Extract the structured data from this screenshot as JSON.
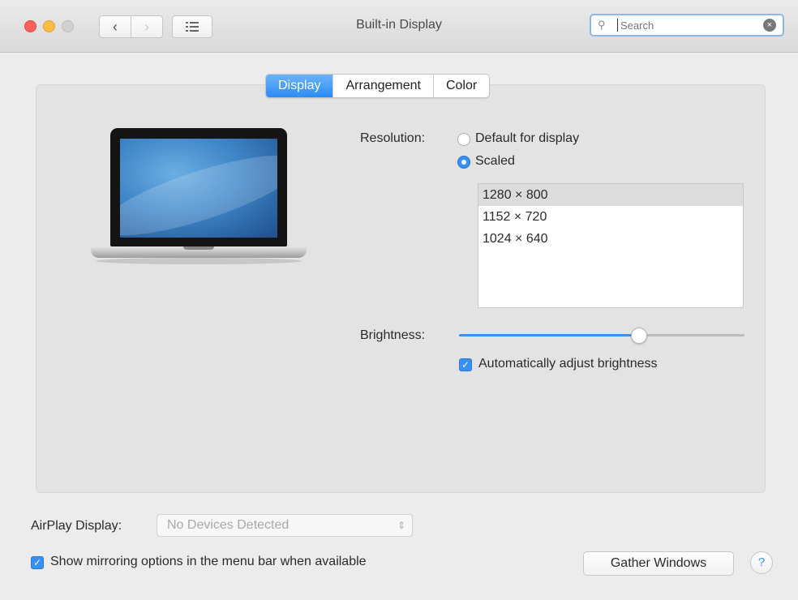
{
  "window": {
    "title": "Built-in Display",
    "search": {
      "placeholder": "Search",
      "value": ""
    },
    "nav": {
      "back": "‹",
      "forward": "›",
      "grid_icon": "grid-icon"
    }
  },
  "tabs": [
    {
      "label": "Display",
      "active": true
    },
    {
      "label": "Arrangement",
      "active": false
    },
    {
      "label": "Color",
      "active": false
    }
  ],
  "display": {
    "resolution_label": "Resolution:",
    "options": [
      {
        "label": "Default for display",
        "selected": false
      },
      {
        "label": "Scaled",
        "selected": true
      }
    ],
    "resolutions": [
      {
        "label": "1280 × 800",
        "selected": true
      },
      {
        "label": "1152 × 720",
        "selected": false
      },
      {
        "label": "1024 × 640",
        "selected": false
      }
    ],
    "brightness_label": "Brightness:",
    "brightness_value": 0.64,
    "auto_brightness_label": "Automatically adjust brightness",
    "auto_brightness_checked": true
  },
  "footer": {
    "airplay_label": "AirPlay Display:",
    "airplay_value": "No Devices Detected",
    "mirroring_label": "Show mirroring options in the menu bar when available",
    "mirroring_checked": true,
    "gather_label": "Gather Windows",
    "help_label": "?"
  },
  "colors": {
    "accent": "#3a8ff5",
    "close": "#fc605c",
    "minimize": "#fdbc40"
  }
}
